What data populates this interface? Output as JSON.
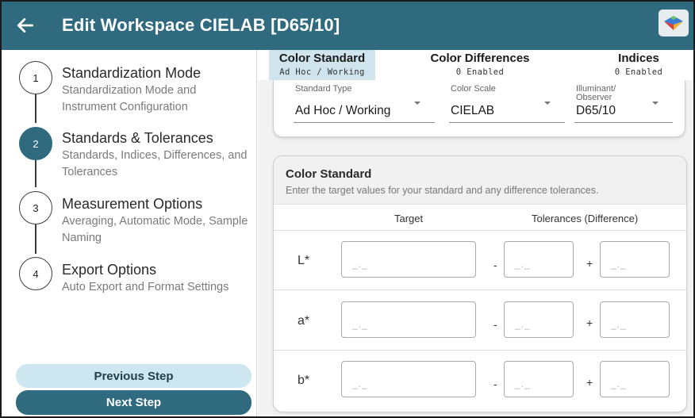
{
  "header": {
    "title": "Edit Workspace CIELAB [D65/10]",
    "back_icon": "arrow-left-icon",
    "logo_icon": "color-cube-logo-icon",
    "bg_color": "#2f6a7f"
  },
  "steps": [
    {
      "number": "1",
      "title": "Standardization Mode",
      "subtitle": "Standardization Mode and Instrument Configuration",
      "active": false
    },
    {
      "number": "2",
      "title": "Standards & Tolerances",
      "subtitle": "Standards, Indices, Differences, and Tolerances",
      "active": true
    },
    {
      "number": "3",
      "title": "Measurement Options",
      "subtitle": "Averaging, Automatic Mode, Sample Naming",
      "active": false
    },
    {
      "number": "4",
      "title": "Export Options",
      "subtitle": "Auto Export and Format Settings",
      "active": false
    }
  ],
  "nav": {
    "previous_label": "Previous Step",
    "next_label": "Next Step"
  },
  "tabs": [
    {
      "label": "Color Standard",
      "sub": "Ad Hoc / Working",
      "active": true
    },
    {
      "label": "Color Differences",
      "sub": "0 Enabled",
      "active": false
    },
    {
      "label": "Indices",
      "sub": "0 Enabled",
      "active": false
    }
  ],
  "settings": {
    "standard_type": {
      "label": "Standard Type",
      "value": "Ad Hoc / Working"
    },
    "color_scale": {
      "label": "Color Scale",
      "value": "CIELAB"
    },
    "illuminant": {
      "label_line1": "Illuminant/",
      "label_line2": "Observer",
      "value": "D65/10"
    }
  },
  "standard": {
    "title": "Color Standard",
    "description": "Enter the target values for your standard and any difference tolerances.",
    "col_target": "Target",
    "col_tolerances": "Tolerances (Difference)",
    "minus": "-",
    "plus": "+",
    "placeholder": "_._",
    "rows": [
      {
        "label": "L*"
      },
      {
        "label": "a*"
      },
      {
        "label": "b*"
      }
    ]
  }
}
